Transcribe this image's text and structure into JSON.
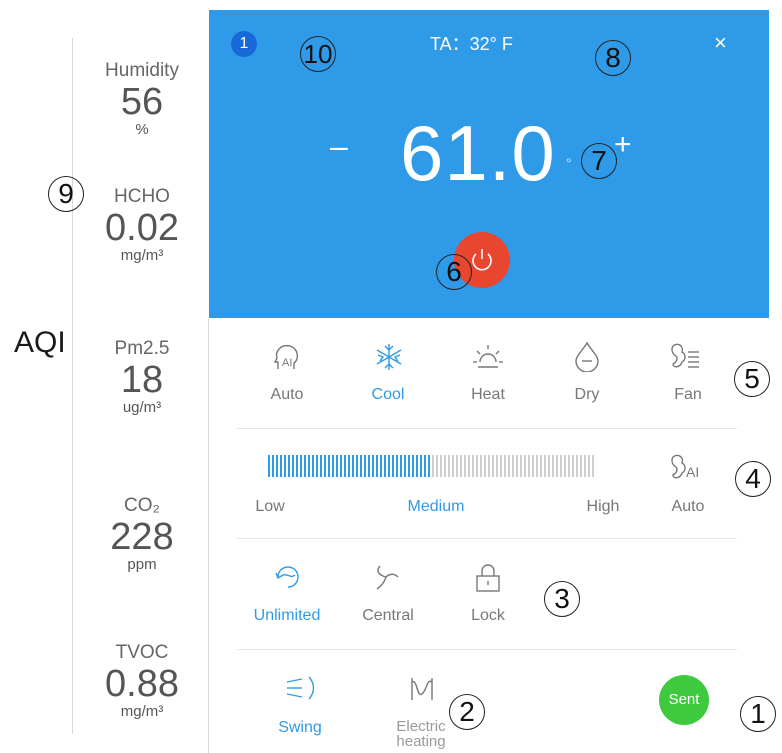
{
  "aqi": {
    "label": "AQI",
    "metrics": [
      {
        "name": "Humidity",
        "value": "56",
        "unit": "%"
      },
      {
        "name": "HCHO",
        "value": "0.02",
        "unit": "mg/m³"
      },
      {
        "name": "Pm2.5",
        "value": "18",
        "unit": "ug/m³"
      },
      {
        "name": "CO₂",
        "value": "228",
        "unit": "ppm"
      },
      {
        "name": "TVOC",
        "value": "0.88",
        "unit": "mg/m³"
      }
    ]
  },
  "control": {
    "badge": "1",
    "ta": "TA：32° F",
    "close": "×",
    "setpoint": "61.0",
    "unit_mark": "°",
    "minus": "–",
    "plus": "+"
  },
  "modes": [
    {
      "label": "Auto",
      "icon": "ai-head-icon",
      "active": false
    },
    {
      "label": "Cool",
      "icon": "snowflake-icon",
      "active": true
    },
    {
      "label": "Heat",
      "icon": "sun-icon",
      "active": false
    },
    {
      "label": "Dry",
      "icon": "droplet-icon",
      "active": false
    },
    {
      "label": "Fan",
      "icon": "fan-icon",
      "active": false
    }
  ],
  "fan_speed": {
    "low": "Low",
    "medium": "Medium",
    "high": "High",
    "auto": "Auto",
    "level": 0.5
  },
  "wind_modes": [
    {
      "label": "Unlimited",
      "icon": "unlimited-icon",
      "active": true
    },
    {
      "label": "Central",
      "icon": "central-icon",
      "active": false
    },
    {
      "label": "Lock",
      "icon": "lock-icon",
      "active": false
    }
  ],
  "extras": [
    {
      "label": "Swing",
      "icon": "swing-icon",
      "active": true
    },
    {
      "label": "Electric heating",
      "icon": "electric-heating-icon",
      "active": false
    }
  ],
  "sent_label": "Sent",
  "callouts": [
    "1",
    "2",
    "3",
    "4",
    "5",
    "6",
    "7",
    "8",
    "9",
    "10"
  ],
  "colors": {
    "accent": "#2f9be8",
    "power": "#e8462f",
    "sent": "#3ec93e",
    "badge": "#1769d8"
  }
}
